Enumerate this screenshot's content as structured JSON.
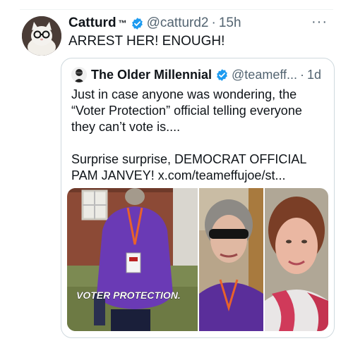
{
  "tweet": {
    "author_name": "Catturd",
    "author_tm": "™",
    "handle": "@catturd2",
    "separator": "·",
    "time": "15h",
    "more_label": "···",
    "text": "ARREST HER!  ENOUGH!"
  },
  "quote": {
    "author_name": "The Older Millennial",
    "handle": "@teameff...",
    "separator": "·",
    "time": "1d",
    "paragraph1": "Just in case anyone was wondering, the “Voter Protection” official telling everyone they can’t vote is....",
    "paragraph2": "Surprise surprise, DEMOCRAT OFFICIAL PAM JANVEY! x.com/teameffujoe/st...",
    "media_caption": "VOTER PROTECTION."
  },
  "colors": {
    "text": "#0f1419",
    "muted": "#536471",
    "verified": "#1d9bf0",
    "border": "#cfd9de"
  },
  "icons": [
    "verified-badge-icon",
    "more-options-icon"
  ]
}
